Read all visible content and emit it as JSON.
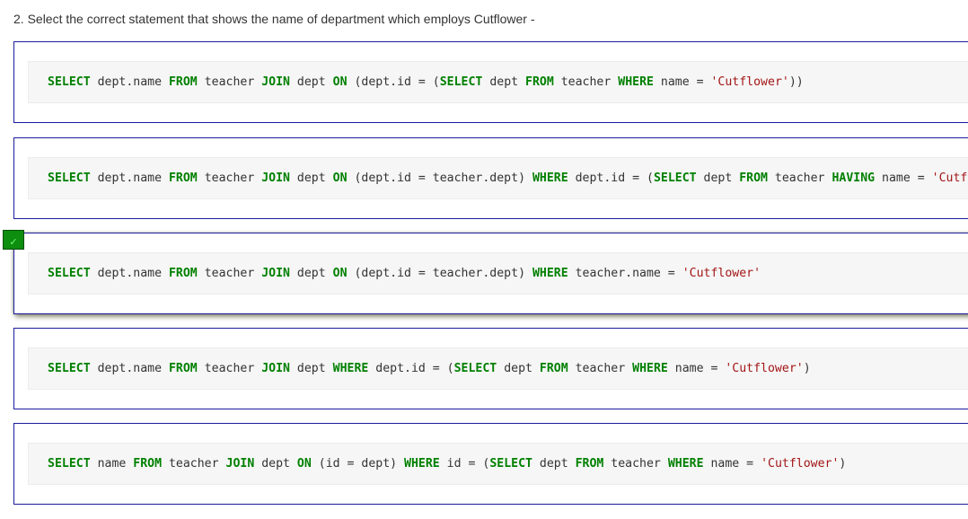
{
  "question": "2. Select the correct statement that shows the name of department which employs Cutflower -",
  "check_glyph": "✓",
  "colors": {
    "keyword": "#008000",
    "string": "#a31515",
    "border": "#1c1c9c",
    "check_bg": "#0e8e0e"
  },
  "options": [
    {
      "tokens": [
        [
          "kw",
          "SELECT"
        ],
        [
          " ",
          " dept.name "
        ],
        [
          "kw",
          "FROM"
        ],
        [
          " ",
          " teacher "
        ],
        [
          "kw",
          "JOIN"
        ],
        [
          " ",
          " dept "
        ],
        [
          "kw",
          "ON"
        ],
        [
          " ",
          " (dept.id = ("
        ],
        [
          "kw",
          "SELECT"
        ],
        [
          " ",
          " dept "
        ],
        [
          "kw",
          "FROM"
        ],
        [
          " ",
          " teacher "
        ],
        [
          "kw",
          "WHERE"
        ],
        [
          " ",
          " name = "
        ],
        [
          "str",
          "'Cutflower'"
        ],
        [
          " ",
          "))"
        ]
      ]
    },
    {
      "tokens": [
        [
          "kw",
          "SELECT"
        ],
        [
          " ",
          " dept.name "
        ],
        [
          "kw",
          "FROM"
        ],
        [
          " ",
          " teacher "
        ],
        [
          "kw",
          "JOIN"
        ],
        [
          " ",
          " dept "
        ],
        [
          "kw",
          "ON"
        ],
        [
          " ",
          " (dept.id = teacher.dept) "
        ],
        [
          "kw",
          "WHERE"
        ],
        [
          " ",
          " dept.id = ("
        ],
        [
          "kw",
          "SELECT"
        ],
        [
          " ",
          " dept "
        ],
        [
          "kw",
          "FROM"
        ],
        [
          " ",
          " teacher "
        ],
        [
          "kw",
          "HAVING"
        ],
        [
          " ",
          " name = "
        ],
        [
          "str",
          "'Cutflower'"
        ],
        [
          " ",
          ")"
        ]
      ]
    },
    {
      "selected": true,
      "tokens": [
        [
          "kw",
          "SELECT"
        ],
        [
          " ",
          " dept.name "
        ],
        [
          "kw",
          "FROM"
        ],
        [
          " ",
          " teacher "
        ],
        [
          "kw",
          "JOIN"
        ],
        [
          " ",
          " dept "
        ],
        [
          "kw",
          "ON"
        ],
        [
          " ",
          " (dept.id = teacher.dept) "
        ],
        [
          "kw",
          "WHERE"
        ],
        [
          " ",
          " teacher.name = "
        ],
        [
          "str",
          "'Cutflower'"
        ]
      ]
    },
    {
      "tokens": [
        [
          "kw",
          "SELECT"
        ],
        [
          " ",
          " dept.name "
        ],
        [
          "kw",
          "FROM"
        ],
        [
          " ",
          " teacher "
        ],
        [
          "kw",
          "JOIN"
        ],
        [
          " ",
          " dept "
        ],
        [
          "kw",
          "WHERE"
        ],
        [
          " ",
          " dept.id = ("
        ],
        [
          "kw",
          "SELECT"
        ],
        [
          " ",
          " dept "
        ],
        [
          "kw",
          "FROM"
        ],
        [
          " ",
          " teacher "
        ],
        [
          "kw",
          "WHERE"
        ],
        [
          " ",
          " name = "
        ],
        [
          "str",
          "'Cutflower'"
        ],
        [
          " ",
          ")"
        ]
      ]
    },
    {
      "tokens": [
        [
          "kw",
          "SELECT"
        ],
        [
          " ",
          " name "
        ],
        [
          "kw",
          "FROM"
        ],
        [
          " ",
          " teacher "
        ],
        [
          "kw",
          "JOIN"
        ],
        [
          " ",
          " dept "
        ],
        [
          "kw",
          "ON"
        ],
        [
          " ",
          " (id = dept) "
        ],
        [
          "kw",
          "WHERE"
        ],
        [
          " ",
          " id = ("
        ],
        [
          "kw",
          "SELECT"
        ],
        [
          " ",
          " dept "
        ],
        [
          "kw",
          "FROM"
        ],
        [
          " ",
          " teacher "
        ],
        [
          "kw",
          "WHERE"
        ],
        [
          " ",
          " name = "
        ],
        [
          "str",
          "'Cutflower'"
        ],
        [
          " ",
          ")"
        ]
      ]
    }
  ]
}
